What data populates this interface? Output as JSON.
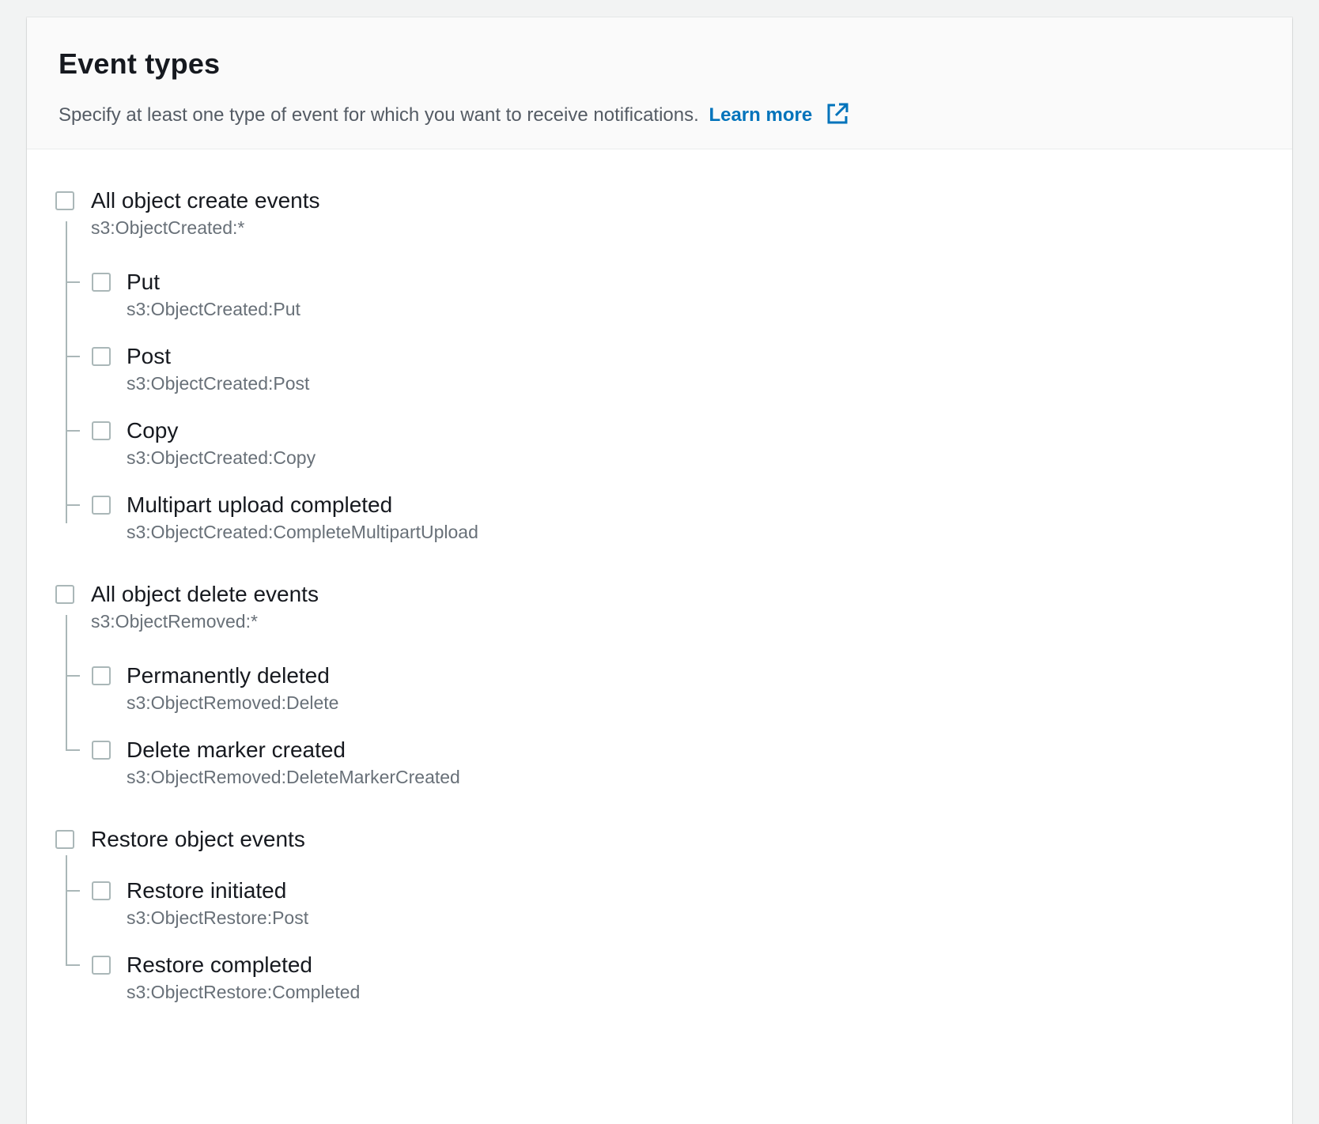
{
  "section": {
    "title": "Event types",
    "description": "Specify at least one type of event for which you want to receive notifications.",
    "learn_more": "Learn more",
    "learn_more_icon": "external-link-icon",
    "accent_color": "#0073bb"
  },
  "groups": [
    {
      "label": "All object create events",
      "event": "s3:ObjectCreated:*",
      "checked": false,
      "children": [
        {
          "label": "Put",
          "event": "s3:ObjectCreated:Put",
          "checked": false
        },
        {
          "label": "Post",
          "event": "s3:ObjectCreated:Post",
          "checked": false
        },
        {
          "label": "Copy",
          "event": "s3:ObjectCreated:Copy",
          "checked": false
        },
        {
          "label": "Multipart upload completed",
          "event": "s3:ObjectCreated:CompleteMultipartUpload",
          "checked": false
        }
      ]
    },
    {
      "label": "All object delete events",
      "event": "s3:ObjectRemoved:*",
      "checked": false,
      "children": [
        {
          "label": "Permanently deleted",
          "event": "s3:ObjectRemoved:Delete",
          "checked": false
        },
        {
          "label": "Delete marker created",
          "event": "s3:ObjectRemoved:DeleteMarkerCreated",
          "checked": false
        }
      ]
    },
    {
      "label": "Restore object events",
      "event": "",
      "checked": false,
      "children": [
        {
          "label": "Restore initiated",
          "event": "s3:ObjectRestore:Post",
          "checked": false
        },
        {
          "label": "Restore completed",
          "event": "s3:ObjectRestore:Completed",
          "checked": false
        }
      ]
    }
  ]
}
